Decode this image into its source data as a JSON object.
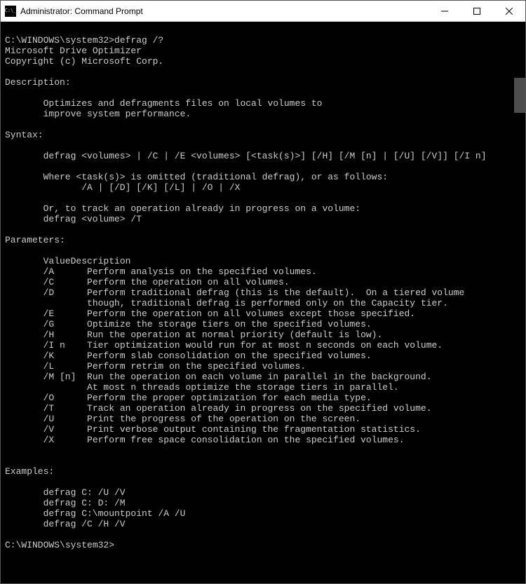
{
  "window": {
    "title": "Administrator: Command Prompt"
  },
  "terminal": {
    "prompt1": "C:\\WINDOWS\\system32>defrag /?",
    "header1": "Microsoft Drive Optimizer",
    "header2": "Copyright (c) Microsoft Corp.",
    "descLabel": "Description:",
    "desc1": "Optimizes and defragments files on local volumes to",
    "desc2": "improve system performance.",
    "syntaxLabel": "Syntax:",
    "syntax1": "defrag <volumes> | /C | /E <volumes> [<task(s)>] [/H] [/M [n] | [/U] [/V]] [/I n]",
    "syntax2": "Where <task(s)> is omitted (traditional defrag), or as follows:",
    "syntax3": "/A | [/D] [/K] [/L] | /O | /X",
    "syntax4": "Or, to track an operation already in progress on a volume:",
    "syntax5": "defrag <volume> /T",
    "paramsLabel": "Parameters:",
    "paramHeadVal": "Value",
    "paramHeadDesc": "Description",
    "params": [
      {
        "v": "/A",
        "d": "Perform analysis on the specified volumes."
      },
      {
        "v": "/C",
        "d": "Perform the operation on all volumes."
      },
      {
        "v": "/D",
        "d": "Perform traditional defrag (this is the default).  On a tiered volume"
      },
      {
        "v": "",
        "d": "though, traditional defrag is performed only on the Capacity tier."
      },
      {
        "v": "/E",
        "d": "Perform the operation on all volumes except those specified."
      },
      {
        "v": "/G",
        "d": "Optimize the storage tiers on the specified volumes."
      },
      {
        "v": "/H",
        "d": "Run the operation at normal priority (default is low)."
      },
      {
        "v": "/I n",
        "d": "Tier optimization would run for at most n seconds on each volume."
      },
      {
        "v": "/K",
        "d": "Perform slab consolidation on the specified volumes."
      },
      {
        "v": "/L",
        "d": "Perform retrim on the specified volumes."
      },
      {
        "v": "/M [n]",
        "d": "Run the operation on each volume in parallel in the background."
      },
      {
        "v": "",
        "d": "At most n threads optimize the storage tiers in parallel."
      },
      {
        "v": "/O",
        "d": "Perform the proper optimization for each media type."
      },
      {
        "v": "/T",
        "d": "Track an operation already in progress on the specified volume."
      },
      {
        "v": "/U",
        "d": "Print the progress of the operation on the screen."
      },
      {
        "v": "/V",
        "d": "Print verbose output containing the fragmentation statistics."
      },
      {
        "v": "/X",
        "d": "Perform free space consolidation on the specified volumes."
      }
    ],
    "examplesLabel": "Examples:",
    "ex1": "defrag C: /U /V",
    "ex2": "defrag C: D: /M",
    "ex3": "defrag C:\\mountpoint /A /U",
    "ex4": "defrag /C /H /V",
    "prompt2": "C:\\WINDOWS\\system32>"
  }
}
